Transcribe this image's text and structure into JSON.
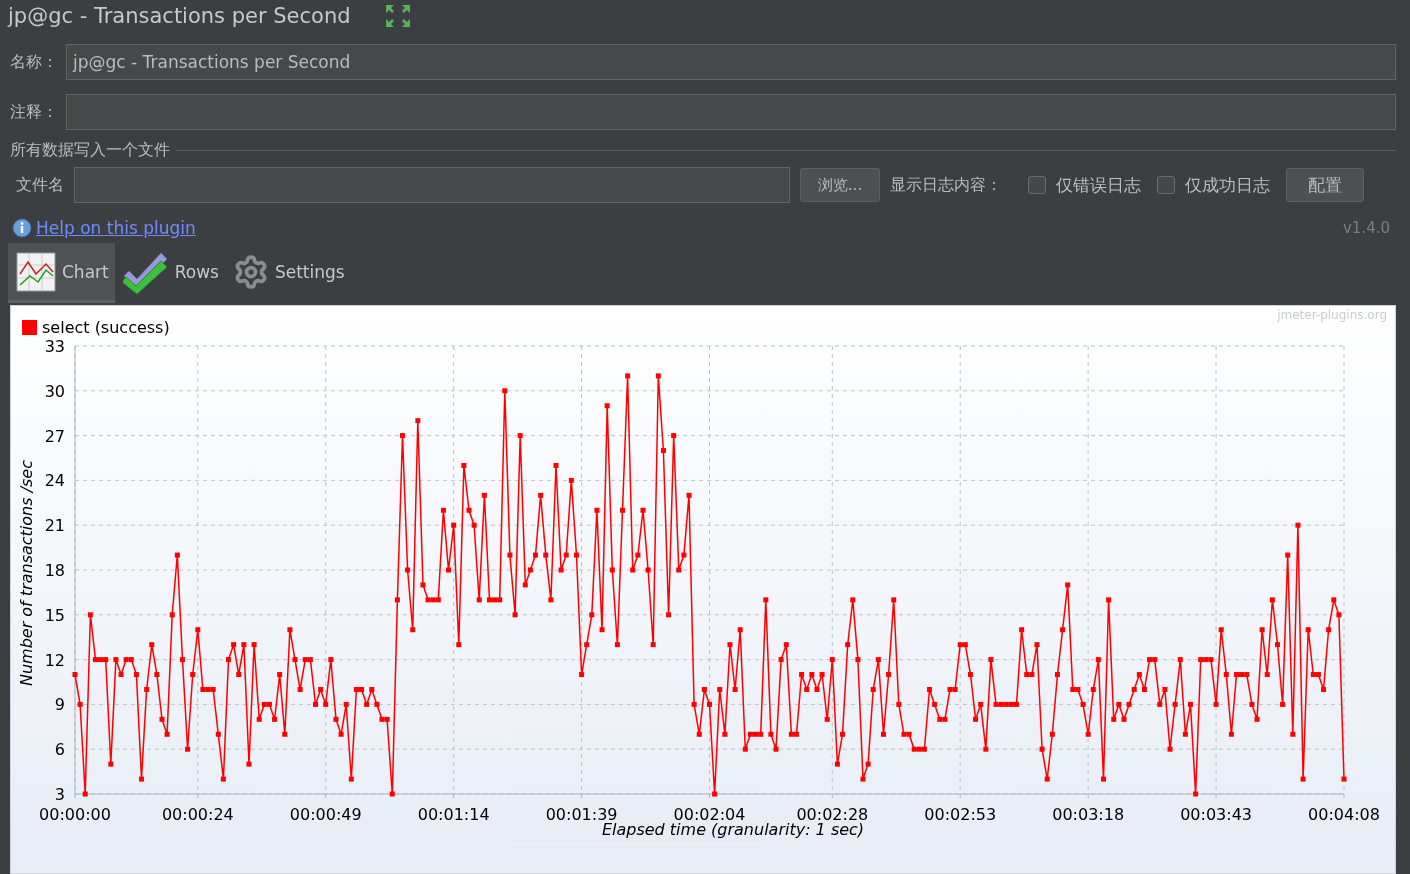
{
  "window": {
    "title": "jp@gc - Transactions per Second"
  },
  "form": {
    "name": {
      "label": "名称：",
      "value": "jp@gc - Transactions per Second"
    },
    "comment": {
      "label": "注释："
    }
  },
  "file_section": {
    "title": "所有数据写入一个文件",
    "file_label": "文件名",
    "browse_button": "浏览...",
    "log_label": "显示日志内容：",
    "options": [
      {
        "label": "仅错误日志",
        "checked": false
      },
      {
        "label": "仅成功日志",
        "checked": false
      }
    ],
    "config_button": "配置"
  },
  "help_link": "Help on this plugin",
  "version": "v1.4.0",
  "tabs": [
    {
      "label": "Chart",
      "selected": true
    },
    {
      "label": "Rows",
      "selected": false
    },
    {
      "label": "Settings",
      "selected": false
    }
  ],
  "chart": {
    "watermark": "jmeter-plugins.org",
    "chart_data": {
      "type": "line",
      "grid": true,
      "xlabel": "Elapsed time (granularity: 1 sec)",
      "ylabel": "Number of transactions /sec",
      "xlim": [
        0,
        248
      ],
      "ylim": [
        3,
        33
      ],
      "xticks": [
        {
          "value": 0,
          "label": "00:00:00"
        },
        {
          "value": 24,
          "label": "00:00:24"
        },
        {
          "value": 49,
          "label": "00:00:49"
        },
        {
          "value": 74,
          "label": "00:01:14"
        },
        {
          "value": 99,
          "label": "00:01:39"
        },
        {
          "value": 124,
          "label": "00:02:04"
        },
        {
          "value": 148,
          "label": "00:02:28"
        },
        {
          "value": 173,
          "label": "00:02:53"
        },
        {
          "value": 198,
          "label": "00:03:18"
        },
        {
          "value": 223,
          "label": "00:03:43"
        },
        {
          "value": 248,
          "label": "00:04:08"
        }
      ],
      "yticks": [
        3,
        6,
        9,
        12,
        15,
        18,
        21,
        24,
        27,
        30,
        33
      ],
      "x": [
        0,
        1,
        2,
        3,
        4,
        5,
        6,
        7,
        8,
        9,
        10,
        11,
        12,
        13,
        14,
        15,
        16,
        17,
        18,
        19,
        20,
        21,
        22,
        23,
        24,
        25,
        26,
        27,
        28,
        29,
        30,
        31,
        32,
        33,
        34,
        35,
        36,
        37,
        38,
        39,
        40,
        41,
        42,
        43,
        44,
        45,
        46,
        47,
        48,
        49,
        50,
        51,
        52,
        53,
        54,
        55,
        56,
        57,
        58,
        59,
        60,
        61,
        62,
        63,
        64,
        65,
        66,
        67,
        68,
        69,
        70,
        71,
        72,
        73,
        74,
        75,
        76,
        77,
        78,
        79,
        80,
        81,
        82,
        83,
        84,
        85,
        86,
        87,
        88,
        89,
        90,
        91,
        92,
        93,
        94,
        95,
        96,
        97,
        98,
        99,
        100,
        101,
        102,
        103,
        104,
        105,
        106,
        107,
        108,
        109,
        110,
        111,
        112,
        113,
        114,
        115,
        116,
        117,
        118,
        119,
        120,
        121,
        122,
        123,
        124,
        125,
        126,
        127,
        128,
        129,
        130,
        131,
        132,
        133,
        134,
        135,
        136,
        137,
        138,
        139,
        140,
        141,
        142,
        143,
        144,
        145,
        146,
        147,
        148,
        149,
        150,
        151,
        152,
        153,
        154,
        155,
        156,
        157,
        158,
        159,
        160,
        161,
        162,
        163,
        164,
        165,
        166,
        167,
        168,
        169,
        170,
        171,
        172,
        173,
        174,
        175,
        176,
        177,
        178,
        179,
        180,
        181,
        182,
        183,
        184,
        185,
        186,
        187,
        188,
        189,
        190,
        191,
        192,
        193,
        194,
        195,
        196,
        197,
        198,
        199,
        200,
        201,
        202,
        203,
        204,
        205,
        206,
        207,
        208,
        209,
        210,
        211,
        212,
        213,
        214,
        215,
        216,
        217,
        218,
        219,
        220,
        221,
        222,
        223,
        224,
        225,
        226,
        227,
        228,
        229,
        230,
        231,
        232,
        233,
        234,
        235,
        236,
        237,
        238,
        239,
        240,
        241,
        242,
        243,
        244,
        245,
        246,
        247,
        248
      ],
      "series": [
        {
          "name": "select (success)",
          "color": "#ff0000",
          "marker": "square",
          "values": [
            11,
            9,
            3,
            15,
            12,
            12,
            12,
            5,
            12,
            11,
            12,
            12,
            11,
            4,
            10,
            13,
            11,
            8,
            7,
            15,
            19,
            12,
            6,
            11,
            14,
            10,
            10,
            10,
            7,
            4,
            12,
            13,
            11,
            13,
            5,
            13,
            8,
            9,
            9,
            8,
            11,
            7,
            14,
            12,
            10,
            12,
            12,
            9,
            10,
            9,
            12,
            8,
            7,
            9,
            4,
            10,
            10,
            9,
            10,
            9,
            8,
            8,
            3,
            16,
            27,
            18,
            14,
            28,
            17,
            16,
            16,
            16,
            22,
            18,
            21,
            13,
            25,
            22,
            21,
            16,
            23,
            16,
            16,
            16,
            30,
            19,
            15,
            27,
            17,
            18,
            19,
            23,
            19,
            16,
            25,
            18,
            19,
            24,
            19,
            11,
            13,
            15,
            22,
            14,
            29,
            18,
            13,
            22,
            31,
            18,
            19,
            22,
            18,
            13,
            31,
            26,
            15,
            27,
            18,
            19,
            23,
            9,
            7,
            10,
            9,
            3,
            10,
            7,
            13,
            10,
            14,
            6,
            7,
            7,
            7,
            16,
            7,
            6,
            12,
            13,
            7,
            7,
            11,
            10,
            11,
            10,
            11,
            8,
            12,
            5,
            7,
            13,
            16,
            12,
            4,
            5,
            10,
            12,
            7,
            11,
            16,
            9,
            7,
            7,
            6,
            6,
            6,
            10,
            9,
            8,
            8,
            10,
            10,
            13,
            13,
            11,
            8,
            9,
            6,
            12,
            9,
            9,
            9,
            9,
            9,
            14,
            11,
            11,
            13,
            6,
            4,
            7,
            11,
            14,
            17,
            10,
            10,
            9,
            7,
            10,
            12,
            4,
            16,
            8,
            9,
            8,
            9,
            10,
            11,
            10,
            12,
            12,
            9,
            10,
            6,
            9,
            12,
            7,
            9,
            3,
            12,
            12,
            12,
            9,
            14,
            11,
            7,
            11,
            11,
            11,
            9,
            8,
            14,
            11,
            16,
            13,
            9,
            19,
            7,
            21,
            4,
            14,
            11,
            11,
            10,
            14,
            16,
            15,
            4
          ]
        }
      ]
    }
  }
}
